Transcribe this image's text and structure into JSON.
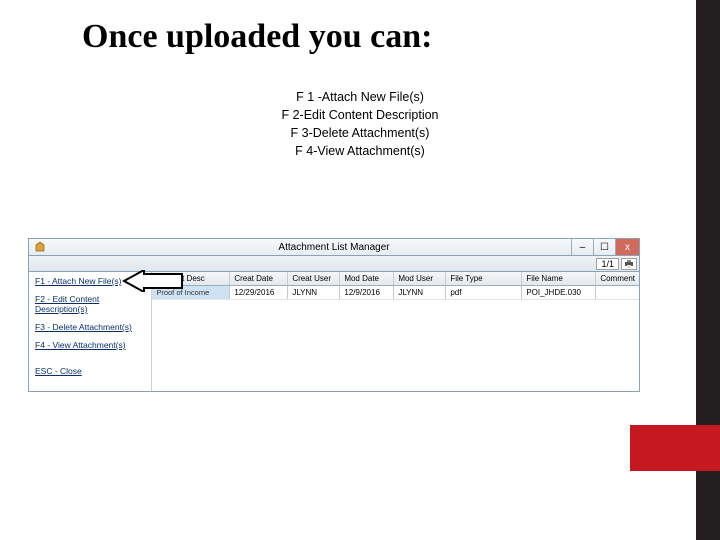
{
  "slide": {
    "title": "Once uploaded you can:",
    "bullets": {
      "b1": "F 1 -Attach New File(s)",
      "b2": "F 2-Edit Content Description",
      "b3": "F 3-Delete Attachment(s)",
      "b4": "F 4-View Attachment(s)"
    }
  },
  "window": {
    "title": "Attachment List Manager",
    "controls": {
      "min": "–",
      "max": "☐",
      "close": "x"
    },
    "counter": "1/1",
    "sidebar": {
      "i1": "F1 - Attach New File(s)",
      "i2": "F2 - Edit Content Description(s)",
      "i3": "F3 - Delete Attachment(s)",
      "i4": "F4 - View Attachment(s)",
      "esc": "ESC - Close"
    },
    "columns": {
      "desc": "Content Desc",
      "cdate": "Creat Date",
      "cuser": "Creat User",
      "mdate": "Mod Date",
      "muser": "Mod User",
      "ftype": "File Type",
      "fname": "File Name",
      "comment": "Comment"
    },
    "row": {
      "desc": "Proof of Income",
      "cdate": "12/29/2016",
      "cuser": "JLYNN",
      "mdate": "12/9/2016",
      "muser": "JLYNN",
      "ftype": "pdf",
      "fname": "POI_JHDE.030",
      "comment": ""
    }
  }
}
